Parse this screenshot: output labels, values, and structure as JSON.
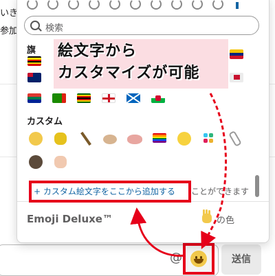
{
  "background": {
    "line1": "いき",
    "line2": "参加"
  },
  "picker": {
    "search_placeholder": "検索",
    "section_flags": "旗",
    "section_custom": "カスタム",
    "add_link": "+ カスタム絵文字をここから追加する",
    "add_link_rest": "ことができます",
    "footer_title": "Emoji Deluxe™",
    "skin_tone_label": "の色"
  },
  "annotation": {
    "banner_line1": "絵文字から",
    "banner_line2": "カスタマイズが可能",
    "highlight_color": "#e6001a",
    "banner_bg": "#fbdde2"
  },
  "composer": {
    "send_label": "送信",
    "at_symbol": "@"
  },
  "emoji_names": {
    "flags_row1": [
      "uganda-flag",
      "venezuela-flag"
    ],
    "flags_row2": [
      "virgin-islands-flag",
      "wallis-futuna-flag"
    ],
    "flags_row3": [
      "south-africa-flag",
      "zambia-flag",
      "zimbabwe-flag",
      "england-flag",
      "scotland-flag",
      "wales-flag"
    ],
    "custom_row1": [
      "money-face",
      "thumbs-down",
      "stick",
      "crab",
      "pig",
      "rainbow-flag",
      "smiley",
      "slack",
      "phone"
    ],
    "custom_row2": [
      "spy",
      "thumbs-up"
    ]
  }
}
